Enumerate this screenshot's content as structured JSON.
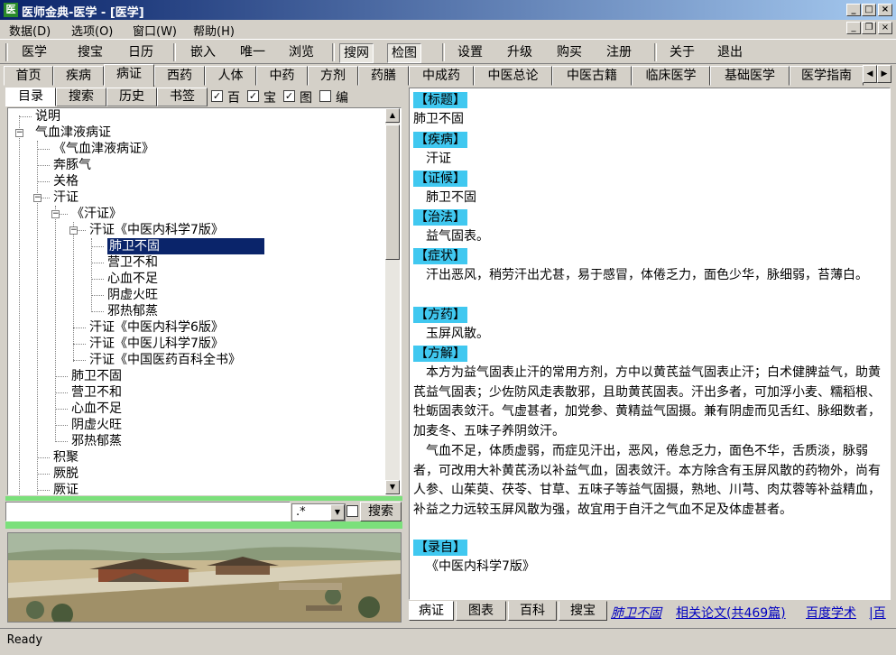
{
  "window": {
    "title": "医师金典-医学 - [医学]",
    "icon": "app-icon"
  },
  "menu": [
    "数据(D)",
    "选项(O)",
    "窗口(W)",
    "帮助(H)"
  ],
  "toolbar": {
    "group1": [
      "医学",
      "搜宝",
      "日历"
    ],
    "group2": [
      "嵌入",
      "唯一",
      "浏览"
    ],
    "group3": [
      "搜网",
      "检图"
    ],
    "group4": [
      "设置",
      "升级",
      "购买",
      "注册"
    ],
    "group5": [
      "关于",
      "退出"
    ]
  },
  "main_tabs": [
    "首页",
    "疾病",
    "病证",
    "西药",
    "人体",
    "中药",
    "方剂",
    "药膳",
    "中成药",
    "中医总论",
    "中医古籍",
    "临床医学",
    "基础医学",
    "医学指南"
  ],
  "main_tab_active": "病证",
  "left_tabs": [
    "目录",
    "搜索",
    "历史",
    "书签"
  ],
  "checks": [
    {
      "label": "百",
      "checked": true
    },
    {
      "label": "宝",
      "checked": true
    },
    {
      "label": "图",
      "checked": true
    },
    {
      "label": "编",
      "checked": false
    }
  ],
  "tree": [
    "说明",
    "气血津液病证",
    "《气血津液病证》",
    "奔豚气",
    "关格",
    "汗证",
    "《汗证》",
    "汗证《中医内科学7版》",
    "肺卫不固",
    "营卫不和",
    "心血不足",
    "阴虚火旺",
    "邪热郁蒸",
    "汗证《中医内科学6版》",
    "汗证《中医儿科学7版》",
    "汗证《中国医药百科全书》",
    "肺卫不固",
    "营卫不和",
    "心血不足",
    "阴虚火旺",
    "邪热郁蒸",
    "积聚",
    "厥脱",
    "厥证"
  ],
  "search": {
    "value": "",
    "pattern": ".*",
    "button": "搜索"
  },
  "content": {
    "sections": [
      {
        "header": "【标题】",
        "text": "肺卫不固",
        "indent": false
      },
      {
        "header": "【疾病】",
        "text": "汗证",
        "indent": true
      },
      {
        "header": "【证候】",
        "text": "肺卫不固",
        "indent": true
      },
      {
        "header": "【治法】",
        "text": "益气固表。",
        "indent": true
      },
      {
        "header": "【症状】",
        "text": "汗出恶风，稍劳汗出尤甚，易于感冒，体倦乏力，面色少华，脉细弱，苔薄白。",
        "indent": true
      },
      {
        "header": "【方药】",
        "text": "玉屏风散。",
        "indent": true
      },
      {
        "header": "【方解】",
        "text": "本方为益气固表止汗的常用方剂，方中以黄芪益气固表止汗；白术健脾益气，助黄芪益气固表；少佐防风走表散邪，且助黄芪固表。汗出多者，可加浮小麦、糯稻根、牡蛎固表敛汗。气虚甚者，加党参、黄精益气固摄。兼有阴虚而见舌红、脉细数者，加麦冬、五味子养阴敛汗。",
        "indent": true,
        "text2": "气血不足，体质虚弱，而症见汗出，恶风，倦怠乏力，面色不华，舌质淡，脉弱者，可改用大补黄芪汤以补益气血，固表敛汗。本方除含有玉屏风散的药物外，尚有人参、山茱萸、茯苓、甘草、五味子等益气固摄，熟地、川芎、肉苁蓉等补益精血，补益之力远较玉屏风散为强，故宜用于自汗之气血不足及体虚甚者。"
      },
      {
        "header": "【录自】",
        "text": "《中医内科学7版》",
        "indent": true
      }
    ]
  },
  "bottom_tabs": [
    "病证",
    "图表",
    "百科",
    "搜宝"
  ],
  "bottom_links": {
    "italic": "肺卫不固",
    "papers": "相关论文(共469篇)",
    "baidu": "百度学术",
    "more": "|百"
  },
  "status": "Ready"
}
